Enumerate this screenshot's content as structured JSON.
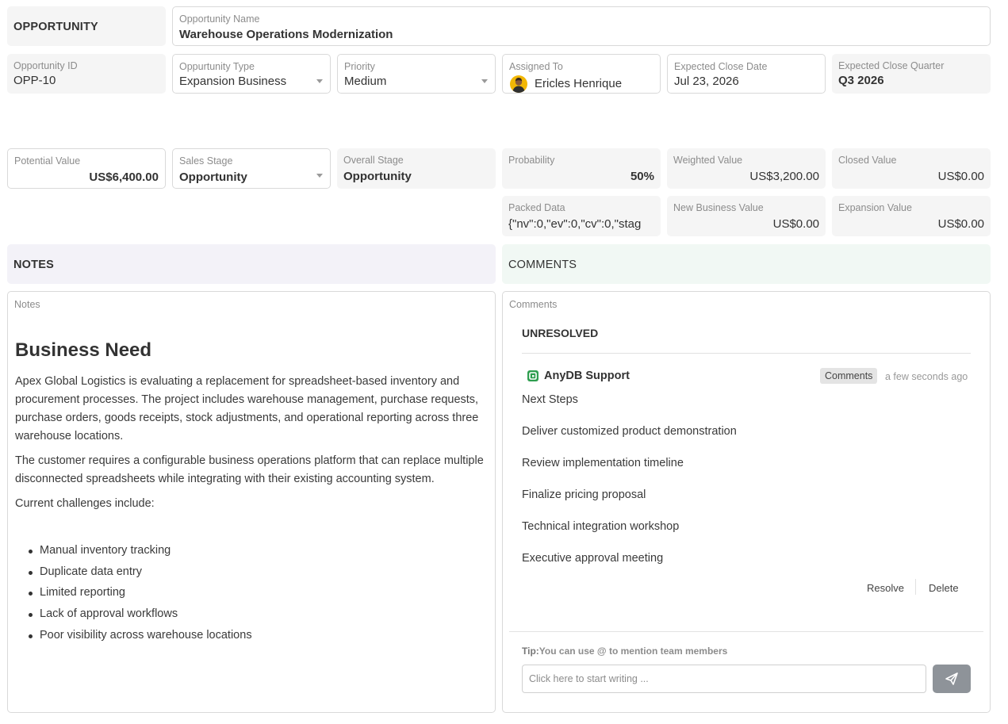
{
  "header": {
    "section_label": "OPPORTUNITY",
    "name_label": "Opportunity Name",
    "name_value": "Warehouse Operations Modernization"
  },
  "row1": {
    "id_label": "Opportunity ID",
    "id_value": "OPP-10",
    "type_label": "Oppurtunity Type",
    "type_value": "Expansion Business",
    "priority_label": "Priority",
    "priority_value": "Medium",
    "assigned_label": "Assigned To",
    "assigned_value": "Ericles Henrique",
    "close_date_label": "Expected Close Date",
    "close_date_value": "Jul 23, 2026",
    "close_quarter_label": "Expected Close Quarter",
    "close_quarter_value": "Q3 2026"
  },
  "row2": {
    "potential_label": "Potential Value",
    "potential_value": "US$6,400.00",
    "stage_label": "Sales Stage",
    "stage_value": "Opportunity",
    "overall_label": "Overall Stage",
    "overall_value": "Opportunity",
    "probability_label": "Probability",
    "probability_value": "50%",
    "weighted_label": "Weighted Value",
    "weighted_value": "US$3,200.00",
    "closed_label": "Closed Value",
    "closed_value": "US$0.00"
  },
  "row3": {
    "packed_label": "Packed Data",
    "packed_value": "{\"nv\":0,\"ev\":0,\"cv\":0,\"stag",
    "new_business_label": "New Business Value",
    "new_business_value": "US$0.00",
    "expansion_label": "Expansion Value",
    "expansion_value": "US$0.00"
  },
  "notes": {
    "section_label": "NOTES",
    "field_label": "Notes",
    "heading": "Business Need",
    "paragraph1": "Apex Global Logistics is evaluating a replacement for spreadsheet-based inventory and procurement processes. The project includes warehouse management, purchase requests, purchase orders, goods receipts, stock adjustments, and operational reporting across three warehouse locations.",
    "paragraph2": "The customer requires a configurable business operations platform that can replace multiple disconnected spreadsheets while integrating with their existing accounting system.",
    "paragraph3": "Current challenges include:",
    "challenges": [
      "Manual inventory tracking",
      "Duplicate data entry",
      "Limited reporting",
      "Lack of approval workflows",
      "Poor visibility across warehouse locations"
    ]
  },
  "comments": {
    "section_label": "COMMENTS",
    "field_label": "Comments",
    "group_label": "UNRESOLVED",
    "author": "AnyDB Support",
    "tag": "Comments",
    "time": "a few seconds ago",
    "steps": [
      "Next Steps",
      "Deliver customized product demonstration",
      "Review implementation timeline",
      "Finalize pricing proposal",
      "Technical integration workshop",
      "Executive approval meeting"
    ],
    "resolve_label": "Resolve",
    "delete_label": "Delete",
    "tip_prefix": "Tip:",
    "tip_text": "You can use @ to mention team members",
    "input_placeholder": "Click here to start writing ..."
  },
  "colors": {
    "notes_header_bg": "#f3f2f8",
    "comments_header_bg": "#f1f8f4",
    "tile_bg": "#f5f5f5",
    "send_button": "#8e9399",
    "anydb_logo": "#2e9e4f"
  }
}
